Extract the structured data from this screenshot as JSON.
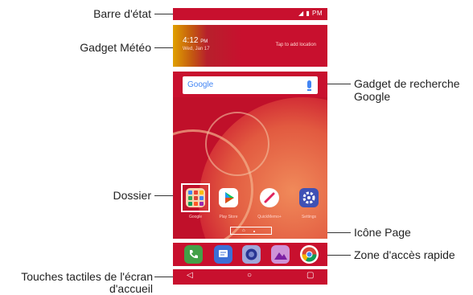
{
  "labels": {
    "status_bar": "Barre d'état",
    "weather_widget": "Gadget Météo",
    "google_widget_line1": "Gadget de recherche",
    "google_widget_line2": "Google",
    "folder": "Dossier",
    "page_icon": "Icône Page",
    "quick_access": "Zone d'accès rapide",
    "home_keys_line1": "Touches tactiles de l'écran",
    "home_keys_line2": "d'accueil"
  },
  "status_bar": {
    "text": "PM"
  },
  "weather": {
    "time": "4:12",
    "period": "PM",
    "date": "Wed, Jan 17",
    "hint": "Tap to add location"
  },
  "search": {
    "logo": "Google"
  },
  "home_apps": [
    {
      "name": "Google",
      "icon": "folder-icon",
      "color": "#f7d5b0"
    },
    {
      "name": "Play Store",
      "icon": "play-store-icon",
      "color": "#ffffff"
    },
    {
      "name": "QuickMemo+",
      "icon": "quickmemo-icon",
      "color": "#e0245e"
    },
    {
      "name": "Settings",
      "icon": "settings-icon",
      "color": "#3f51b5"
    }
  ],
  "dock_apps": [
    {
      "name": "Phone",
      "icon": "phone-icon",
      "color": "#43a047"
    },
    {
      "name": "Messaging",
      "icon": "messaging-icon",
      "color": "#3d6fd6"
    },
    {
      "name": "Camera",
      "icon": "camera-icon",
      "color": "#5c6bc0"
    },
    {
      "name": "Gallery",
      "icon": "gallery-icon",
      "color": "#9c27b0"
    },
    {
      "name": "Chrome",
      "icon": "chrome-icon",
      "color": "#ffffff"
    }
  ],
  "navigation": {
    "back": "◁",
    "home": "○",
    "recents": "▢"
  },
  "colors": {
    "phone_red": "#c8102e",
    "leader": "#333333"
  }
}
